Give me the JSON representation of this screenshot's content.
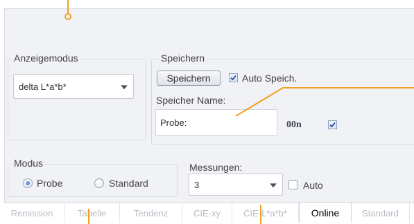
{
  "display_mode": {
    "legend": "Anzeigemodus",
    "selected": "delta L*a*b*"
  },
  "save": {
    "legend": "Speichern",
    "button_label": "Speichern",
    "auto_save_label": "Auto Speich.",
    "auto_save_checked": true,
    "name_label": "Speicher Name:",
    "name_value": "Probe:",
    "counter_label": "00n",
    "counter_checked": true
  },
  "mode": {
    "legend": "Modus",
    "options": [
      {
        "label": "Probe",
        "selected": true
      },
      {
        "label": "Standard",
        "selected": false
      }
    ]
  },
  "measurements": {
    "label": "Messungen:",
    "selected": "3",
    "auto_label": "Auto",
    "auto_checked": false
  },
  "tabs": [
    {
      "label": "Remission",
      "active": false
    },
    {
      "label": "Tabelle",
      "active": false
    },
    {
      "label": "Tendenz",
      "active": false
    },
    {
      "label": "CIE-xy",
      "active": false
    },
    {
      "label": "CIE-L*a*b*",
      "active": false
    },
    {
      "label": "Online",
      "active": true
    },
    {
      "label": "Standard",
      "active": false
    }
  ],
  "colors": {
    "callout": "#f0a020",
    "panel_bg": "#f1f2f5",
    "check_mark": "#2a4f9a",
    "radio_dot": "#2f64c8"
  }
}
